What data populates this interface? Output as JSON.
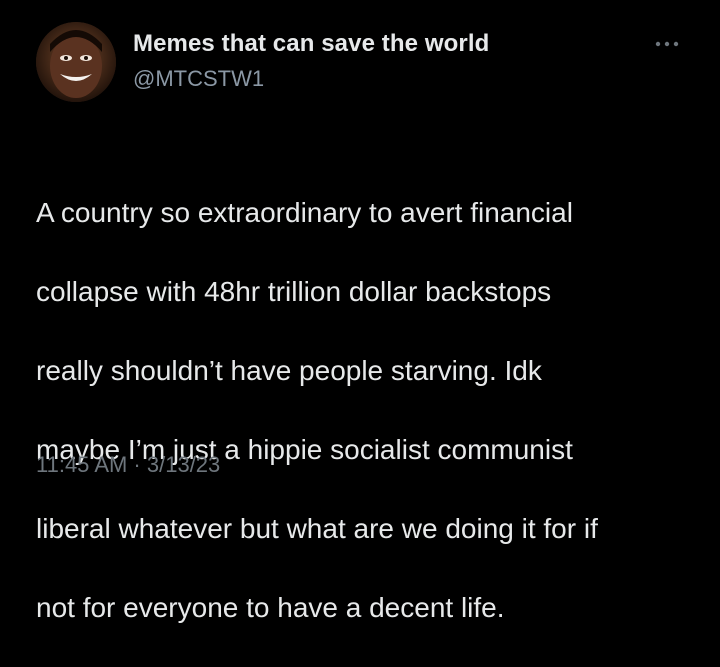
{
  "tweet": {
    "author": {
      "display_name": "Memes that can save the world",
      "handle": "@MTCSTW1",
      "avatar_icon": "profile-avatar"
    },
    "more_icon": "more-options-icon",
    "text_lines": [
      "A country so extraordinary to avert financial",
      "collapse with 48hr trillion dollar backstops",
      "really shouldn’t have people starving. Idk",
      "maybe I’m just a hippie socialist communist",
      "liberal whatever but what are we doing it for if",
      "not for everyone to have a decent life."
    ],
    "timestamp": "11:45 AM · 3/13/23"
  },
  "colors": {
    "background": "#000000",
    "primary_text": "#e7e9ea",
    "secondary_text": "#8b98a5",
    "timestamp_text": "#6e767d"
  }
}
